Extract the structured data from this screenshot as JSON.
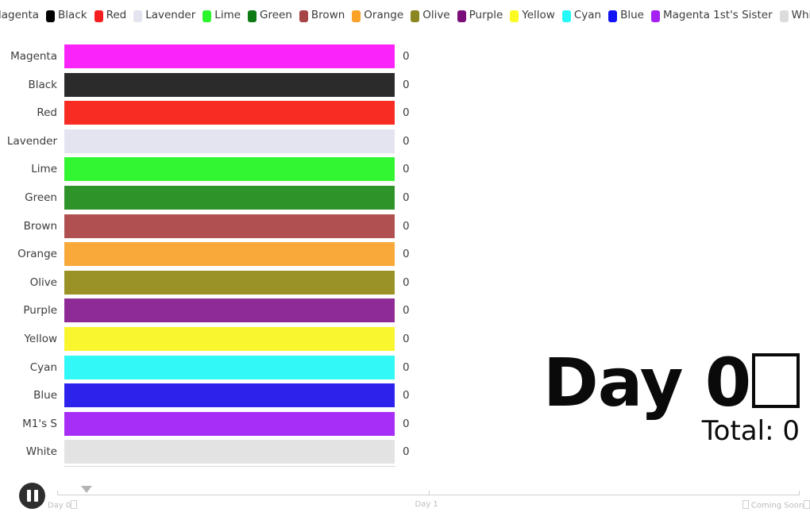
{
  "legend": {
    "items": [
      {
        "label": "Magenta",
        "color": "#ff00ff"
      },
      {
        "label": "Black",
        "color": "#000000"
      },
      {
        "label": "Red",
        "color": "#f41f1f"
      },
      {
        "label": "Lavender",
        "color": "#e4e4f0"
      },
      {
        "label": "Lime",
        "color": "#2bf52b"
      },
      {
        "label": "Green",
        "color": "#0d7a14"
      },
      {
        "label": "Brown",
        "color": "#a64545"
      },
      {
        "label": "Orange",
        "color": "#f9a227"
      },
      {
        "label": "Olive",
        "color": "#8a8621"
      },
      {
        "label": "Purple",
        "color": "#7a0f7a"
      },
      {
        "label": "Yellow",
        "color": "#fbfb22"
      },
      {
        "label": "Cyan",
        "color": "#24f9f9"
      },
      {
        "label": "Blue",
        "color": "#1212f2"
      },
      {
        "label": "Magenta 1st's Sister",
        "color": "#a520f2"
      },
      {
        "label": "White",
        "color": "#dcdcdc"
      }
    ]
  },
  "chart_data": {
    "type": "bar",
    "orientation": "horizontal",
    "title": "",
    "xlabel": "",
    "ylabel": "",
    "xlim": [
      0,
      1
    ],
    "grid": false,
    "legend_position": "top",
    "categories": [
      "Magenta",
      "Black",
      "Red",
      "Lavender",
      "Lime",
      "Green",
      "Brown",
      "Orange",
      "Olive",
      "Purple",
      "Yellow",
      "Cyan",
      "Blue",
      "M1's S",
      "White"
    ],
    "values": [
      0,
      0,
      0,
      0,
      0,
      0,
      0,
      0,
      0,
      0,
      0,
      0,
      0,
      0,
      0
    ],
    "value_labels": [
      "0",
      "0",
      "0",
      "0",
      "0",
      "0",
      "0",
      "0",
      "0",
      "0",
      "0",
      "0",
      "0",
      "0",
      "0"
    ],
    "bar_colors": [
      "#fa24fa",
      "#2b2b2b",
      "#f82c23",
      "#e4e4f0",
      "#33f633",
      "#2e9329",
      "#b15050",
      "#f9a93a",
      "#9a9226",
      "#8f2b96",
      "#f9f62f",
      "#33f8f8",
      "#2d21ec",
      "#a72ef6",
      "#e3e3e3"
    ]
  },
  "day_counter": {
    "title_prefix": "Day 0",
    "total_label": "Total: 0"
  },
  "controls": {
    "play_pause_state": "pause",
    "slider": {
      "ticks": [
        {
          "label": "Day 0",
          "has_tofu_after": true,
          "position_pct": 0
        },
        {
          "label": "Day 1",
          "has_tofu_after": false,
          "position_pct": 50
        },
        {
          "label": "Coming Soon",
          "has_tofu_before": true,
          "has_tofu_after": true,
          "position_pct": 100
        }
      ],
      "handle_position_pct": 4
    }
  },
  "colors": {
    "background": "#ffffff",
    "text": "#3c3c3c",
    "muted": "#bcbcbc",
    "track": "#d0d0d0",
    "button": "#2e2e2e"
  }
}
